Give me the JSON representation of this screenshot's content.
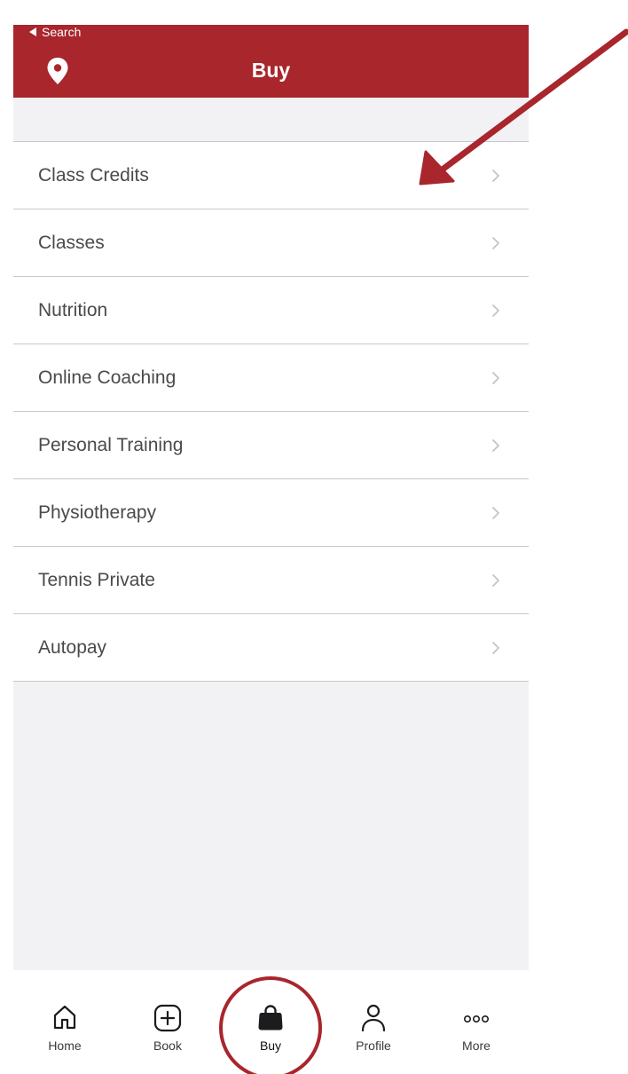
{
  "header": {
    "back_label": "Search",
    "title": "Buy"
  },
  "list": {
    "items": [
      {
        "label": "Class Credits"
      },
      {
        "label": "Classes"
      },
      {
        "label": "Nutrition"
      },
      {
        "label": "Online Coaching"
      },
      {
        "label": "Personal Training"
      },
      {
        "label": "Physiotherapy"
      },
      {
        "label": "Tennis Private"
      },
      {
        "label": "Autopay"
      }
    ]
  },
  "tabbar": {
    "active": "Buy",
    "tabs": [
      {
        "label": "Home",
        "icon": "home-icon"
      },
      {
        "label": "Book",
        "icon": "plus-box-icon"
      },
      {
        "label": "Buy",
        "icon": "shopping-bag-icon"
      },
      {
        "label": "Profile",
        "icon": "person-icon"
      },
      {
        "label": "More",
        "icon": "more-dots-icon"
      }
    ]
  },
  "colors": {
    "header_bg": "#a8262c",
    "annotation": "#a8262c",
    "list_bg": "#ffffff",
    "page_bg": "#f2f2f4"
  }
}
